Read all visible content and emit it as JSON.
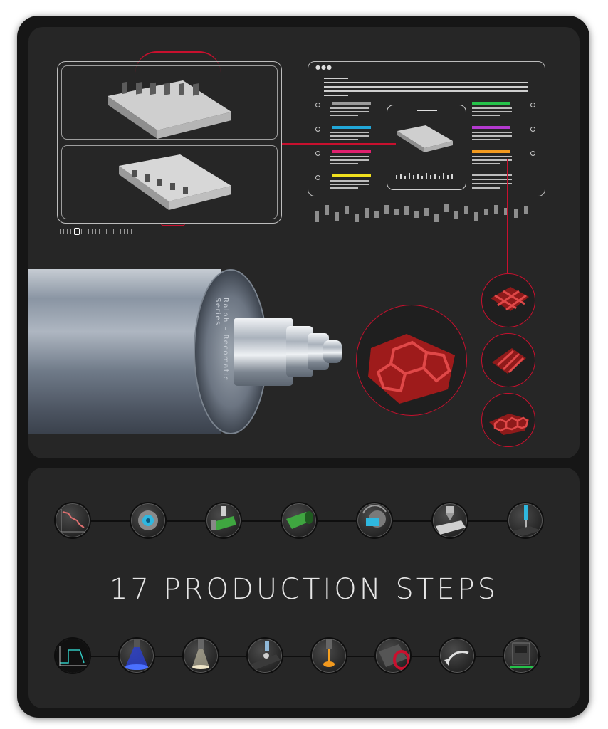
{
  "headline": "17 PRODUCTION STEPS",
  "roller_engraving": "Ralph – Recomatic Series",
  "colors": {
    "accent": "#c8102e",
    "panel": "#262626",
    "frame": "#161616",
    "dashboard_bars": [
      "#9a9a9a",
      "#22a7d8",
      "#e0206e",
      "#f0e01e",
      "#25c24a",
      "#b43ad0",
      "#f39a1e"
    ]
  },
  "top_steps": [
    {
      "icon": "step-chart-icon"
    },
    {
      "icon": "step-chuck-icon"
    },
    {
      "icon": "step-drill-icon"
    },
    {
      "icon": "step-green-tube-icon"
    },
    {
      "icon": "step-blue-part-icon"
    },
    {
      "icon": "step-press-icon"
    },
    {
      "icon": "step-stylus-icon"
    }
  ],
  "bottom_steps": [
    {
      "icon": "step-graph-icon"
    },
    {
      "icon": "step-blue-laser-icon"
    },
    {
      "icon": "step-white-laser-icon"
    },
    {
      "icon": "step-probe-icon"
    },
    {
      "icon": "step-orange-laser-icon"
    },
    {
      "icon": "step-roller-red-icon"
    },
    {
      "icon": "step-arrow-icon"
    },
    {
      "icon": "step-machine-icon"
    }
  ]
}
